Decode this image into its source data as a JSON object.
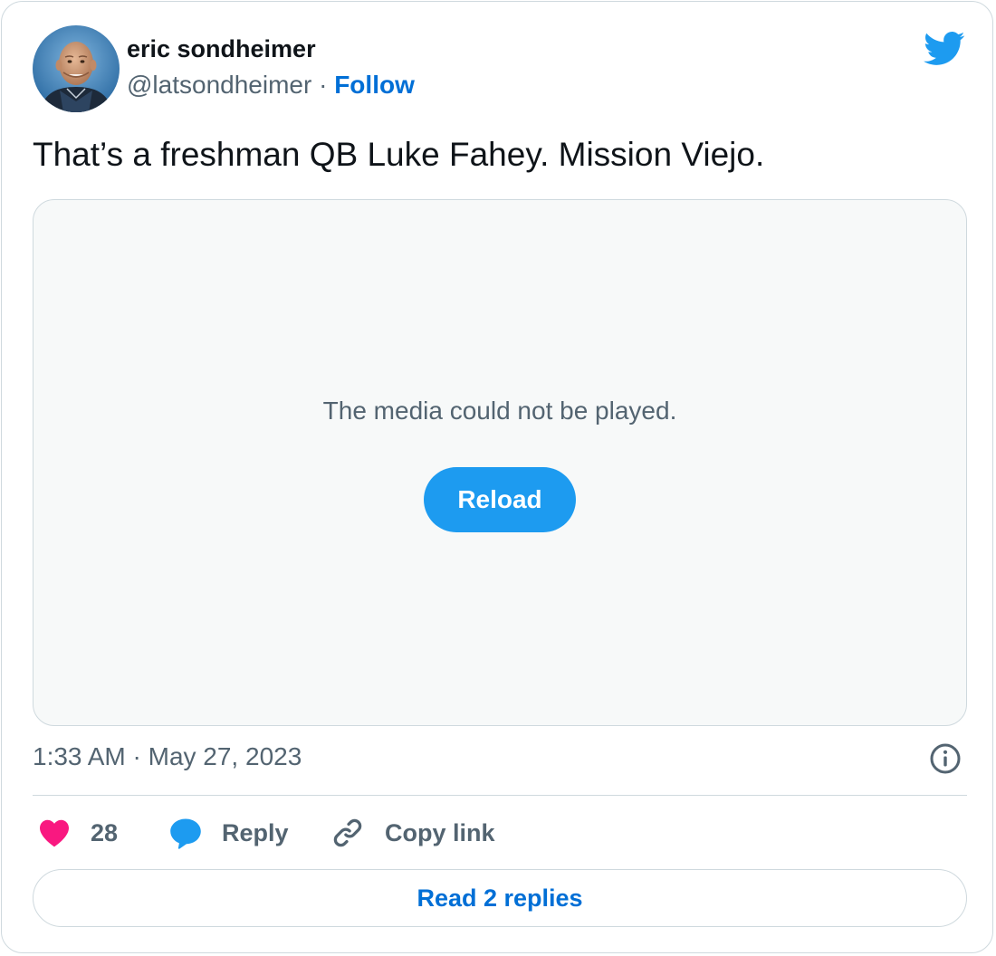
{
  "author": {
    "display_name": "eric sondheimer",
    "handle": "@latsondheimer",
    "separator": "·",
    "follow_label": "Follow"
  },
  "brand_icon": "twitter-bird-icon",
  "tweet": {
    "text": "That’s a freshman QB Luke Fahey. Mission Viejo."
  },
  "media": {
    "error_message": "The media could not be played.",
    "reload_label": "Reload"
  },
  "timestamp": "1:33 AM · May 27, 2023",
  "actions": {
    "like_count": "28",
    "reply_label": "Reply",
    "copy_link_label": "Copy link"
  },
  "read_replies_label": "Read 2 replies",
  "colors": {
    "brand_blue": "#1d9bf0",
    "link_blue": "#006fd6",
    "like_pink": "#f91880",
    "secondary_text": "#536471",
    "border": "#cfd9de",
    "media_bg": "#f7f9f9"
  }
}
